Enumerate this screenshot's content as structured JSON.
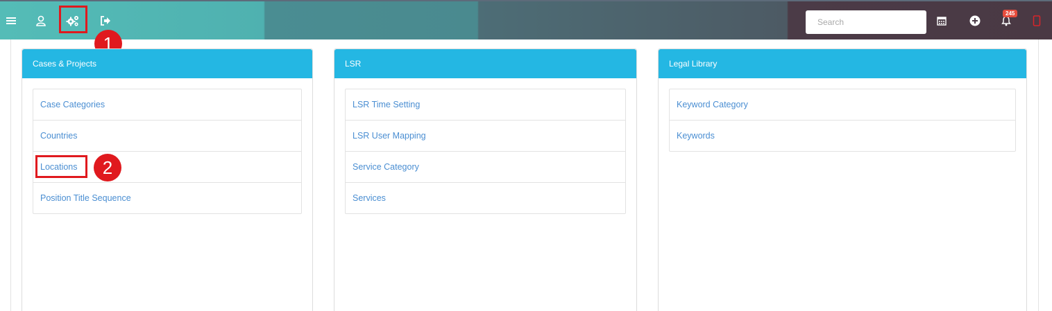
{
  "topbar": {
    "search_placeholder": "Search",
    "notification_count": "245"
  },
  "annotations": {
    "step1": "1",
    "step2": "2"
  },
  "cards": [
    {
      "title": "Cases & Projects",
      "items": [
        "Case Categories",
        "Countries",
        "Locations",
        "Position Title Sequence"
      ]
    },
    {
      "title": "LSR",
      "items": [
        "LSR Time Setting",
        "LSR User Mapping",
        "Service Category",
        "Services"
      ]
    },
    {
      "title": "Legal Library",
      "items": [
        "Keyword Category",
        "Keywords"
      ]
    }
  ],
  "colors": {
    "header_accent": "#24b7e3",
    "link": "#4a8ed2",
    "highlight": "#e0191e"
  }
}
